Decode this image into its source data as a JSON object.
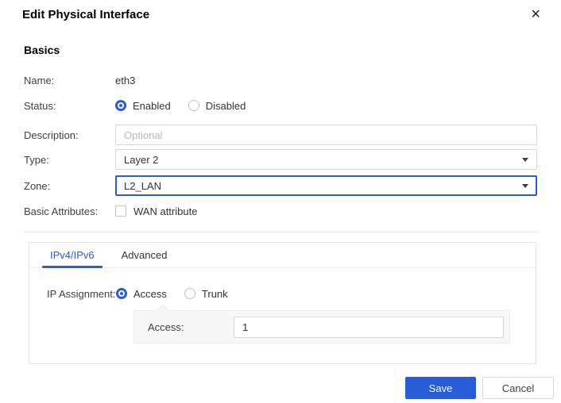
{
  "dialog": {
    "title": "Edit Physical Interface"
  },
  "icons": {
    "close": "×"
  },
  "basics": {
    "heading": "Basics",
    "name": {
      "label": "Name:",
      "value": "eth3"
    },
    "status": {
      "label": "Status:",
      "options": [
        {
          "label": "Enabled",
          "selected": true
        },
        {
          "label": "Disabled",
          "selected": false
        }
      ]
    },
    "description": {
      "label": "Description:",
      "value": "",
      "placeholder": "Optional"
    },
    "type": {
      "label": "Type:",
      "value": "Layer 2"
    },
    "zone": {
      "label": "Zone:",
      "value": "L2_LAN"
    },
    "basic_attributes": {
      "label": "Basic Attributes:",
      "option_label": "WAN attribute",
      "checked": false
    }
  },
  "tabs": {
    "items": [
      {
        "label": "IPv4/IPv6",
        "active": true
      },
      {
        "label": "Advanced",
        "active": false
      }
    ]
  },
  "ipv4_panel": {
    "ip_assignment": {
      "label": "IP Assignment:",
      "options": [
        {
          "label": "Access",
          "selected": true
        },
        {
          "label": "Trunk",
          "selected": false
        }
      ]
    },
    "access": {
      "label": "Access:",
      "value": "1"
    }
  },
  "footer": {
    "save": "Save",
    "cancel": "Cancel"
  },
  "colors": {
    "accent": "#2a5cd8",
    "input_border": "#d6d6d6",
    "panel_bg": "#f7f7f7",
    "divider": "#e6e6e6"
  }
}
